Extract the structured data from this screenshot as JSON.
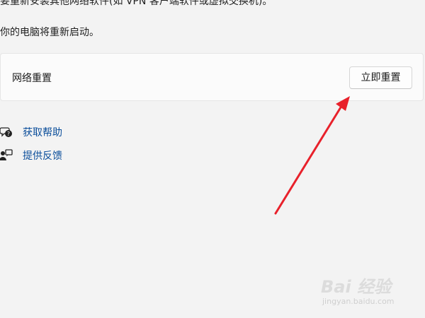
{
  "top_cut_text": "要重新安装其他网络软件(如 VPN 客户端软件或虚拟交换机)。",
  "restart_note": "你的电脑将重新启动。",
  "network_reset_card": {
    "title": "网络重置",
    "button_label": "立即重置"
  },
  "links": [
    {
      "label": "获取帮助",
      "icon": "help-chat-icon"
    },
    {
      "label": "提供反馈",
      "icon": "feedback-icon"
    }
  ],
  "annotation_arrow": {
    "color": "#e8212b"
  },
  "watermark": {
    "main": "Bai 经验",
    "sub": "jingyan.baidu.com"
  }
}
